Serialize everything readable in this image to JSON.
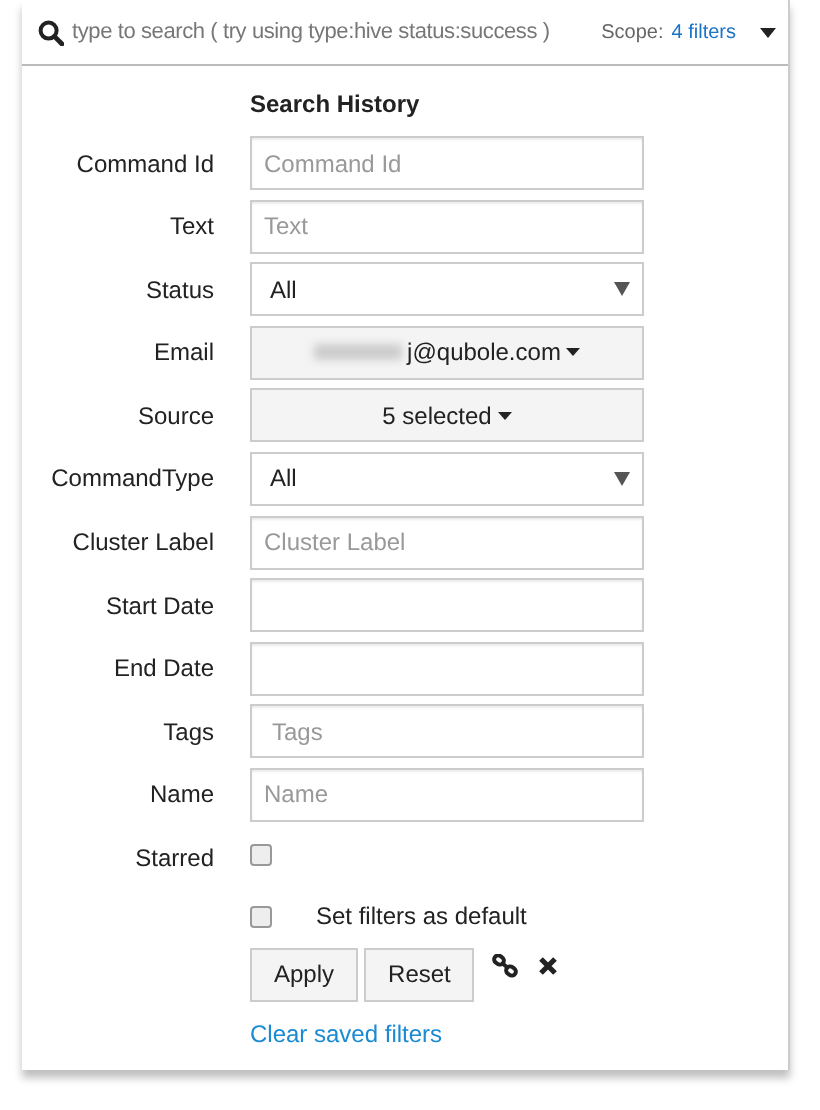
{
  "search": {
    "placeholder": "type to search ( try using type:hive status:success )",
    "scope_label": "Scope:",
    "scope_value": "4 filters"
  },
  "panel": {
    "title": "Search History",
    "fields": [
      {
        "label": "Command Id",
        "kind": "text",
        "placeholder": "Command Id"
      },
      {
        "label": "Text",
        "kind": "text",
        "placeholder": "Text"
      },
      {
        "label": "Status",
        "kind": "select",
        "value": "All"
      },
      {
        "label": "Email",
        "kind": "dropdown",
        "value": "j@qubole.com",
        "redacted": true
      },
      {
        "label": "Source",
        "kind": "dropdown",
        "value": "5 selected"
      },
      {
        "label": "CommandType",
        "kind": "select",
        "value": "All"
      },
      {
        "label": "Cluster Label",
        "kind": "text",
        "placeholder": "Cluster Label"
      },
      {
        "label": "Start Date",
        "kind": "text"
      },
      {
        "label": "End Date",
        "kind": "text"
      },
      {
        "label": "Tags",
        "kind": "tags",
        "placeholder": "Tags"
      },
      {
        "label": "Name",
        "kind": "text",
        "placeholder": "Name"
      },
      {
        "label": "Starred",
        "kind": "checkbox",
        "checked": false
      }
    ],
    "default_option": {
      "label": "Set filters as default",
      "checked": false
    },
    "buttons": [
      "Apply",
      "Reset"
    ],
    "clear_link": "Clear saved filters"
  }
}
